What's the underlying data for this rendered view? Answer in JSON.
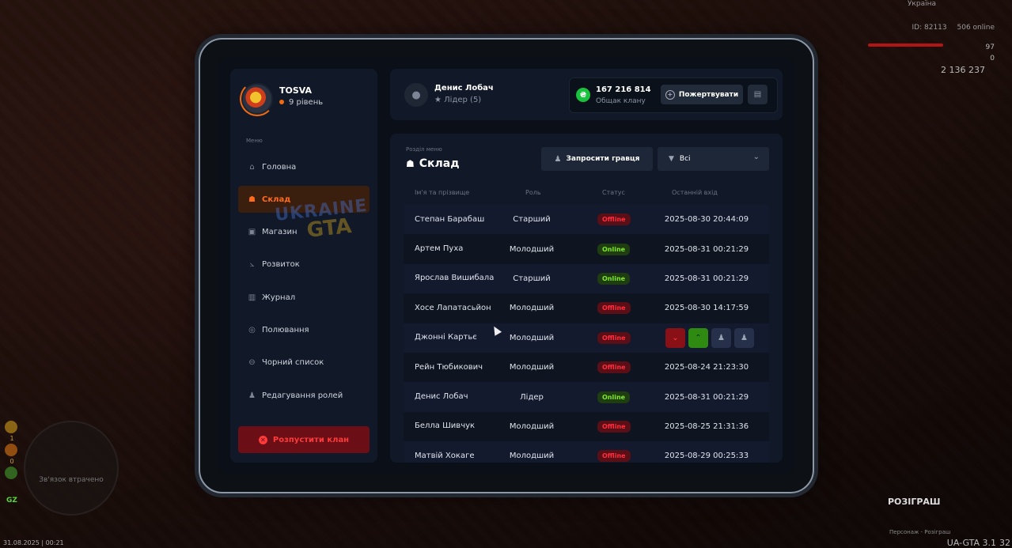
{
  "hud": {
    "country": "Україна",
    "id": "ID: 82113",
    "online": "506 online",
    "health": "97",
    "armor": "0",
    "money": "2 136 237",
    "minimap_text": "Зв'язок втрачено",
    "dot_values": [
      "1",
      "0"
    ],
    "gz": "GZ",
    "date": "31.08.2025 | 00:21",
    "version": "UA-GTA 3.1",
    "fps": "32",
    "giveaway_title": "РОЗІГРАШ",
    "giveaway_sub": "Персонаж - Розіграш"
  },
  "sidebar": {
    "clan_name": "TOSVA",
    "clan_level": "9 рівень",
    "menu_label": "Меню",
    "items": [
      {
        "label": "Головна",
        "icon": "home-icon",
        "glyph": "⌂"
      },
      {
        "label": "Склад",
        "icon": "people-icon",
        "glyph": "☗"
      },
      {
        "label": "Магазин",
        "icon": "shop-icon",
        "glyph": "▣"
      },
      {
        "label": "Розвиток",
        "icon": "chart-icon",
        "glyph": "⦣"
      },
      {
        "label": "Журнал",
        "icon": "book-icon",
        "glyph": "▥"
      },
      {
        "label": "Полювання",
        "icon": "target-icon",
        "glyph": "◎"
      },
      {
        "label": "Чорний список",
        "icon": "block-icon",
        "glyph": "⊖"
      },
      {
        "label": "Редагування ролей",
        "icon": "user-edit-icon",
        "glyph": "♟"
      }
    ],
    "active_index": 1,
    "dissolve_label": "Розпустити клан"
  },
  "header": {
    "user_name": "Денис Лобач",
    "user_role": "Лідер (5)",
    "fund_amount": "167 216 814",
    "fund_label": "Общак клану",
    "donate_label": "Пожертвувати"
  },
  "panel": {
    "section_small": "Розділ меню",
    "section_title": "Склад",
    "invite_label": "Запросити гравця",
    "filter_value": "Всі",
    "columns": [
      "Ім'я та прізвище",
      "Роль",
      "Статус",
      "Останній вхід"
    ],
    "rows": [
      {
        "name": "Степан Барабаш",
        "role": "Старший",
        "status": "Offline",
        "last": "2025-08-30 20:44:09"
      },
      {
        "name": "Артем Пуха",
        "role": "Молодший",
        "status": "Online",
        "last": "2025-08-31 00:21:29"
      },
      {
        "name": "Ярослав Вишибала",
        "role": "Старший",
        "status": "Online",
        "last": "2025-08-31 00:21:29"
      },
      {
        "name": "Хосе Лапатасьйон",
        "role": "Молодший",
        "status": "Offline",
        "last": "2025-08-30 14:17:59"
      },
      {
        "name": "Джонні Картьє",
        "role": "Молодший",
        "status": "Offline",
        "last": ""
      },
      {
        "name": "Рейн Тюбикович",
        "role": "Молодший",
        "status": "Offline",
        "last": "2025-08-24 21:23:30"
      },
      {
        "name": "Денис Лобач",
        "role": "Лідер",
        "status": "Online",
        "last": "2025-08-31 00:21:29"
      },
      {
        "name": "Белла Шивчук",
        "role": "Молодший",
        "status": "Offline",
        "last": "2025-08-25 21:31:36"
      },
      {
        "name": "Матвій Хокаге",
        "role": "Молодший",
        "status": "Offline",
        "last": "2025-08-29 00:25:33"
      }
    ],
    "hover_row_index": 4
  },
  "watermark": {
    "line1": "UKRAINE",
    "line2": "GTA"
  },
  "colors": {
    "accent": "#ff6a1c",
    "online": "#7fe82a",
    "offline": "#ff2d3d",
    "fund_icon": "#18c23d"
  }
}
